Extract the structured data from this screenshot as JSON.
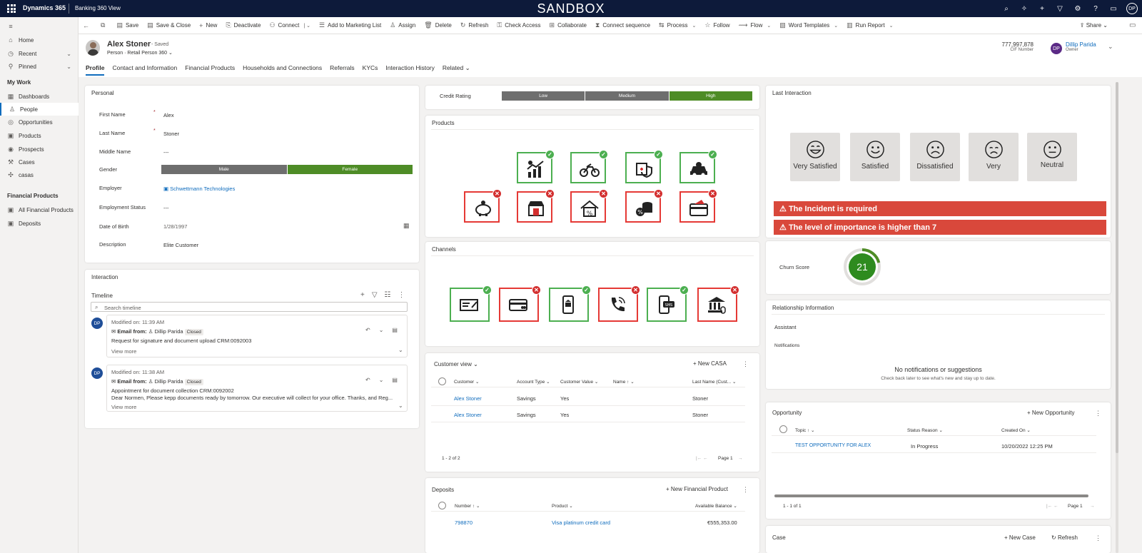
{
  "topbar": {
    "brand": "Dynamics 365",
    "app_name": "Banking 360 View",
    "environment": "SANDBOX",
    "user_initials": "DP"
  },
  "leftnav": {
    "items": [
      {
        "label": "Home",
        "icon": "home-icon"
      },
      {
        "label": "Recent",
        "icon": "clock-icon"
      },
      {
        "label": "Pinned",
        "icon": "pin-icon"
      }
    ],
    "my_work_header": "My Work",
    "my_work": [
      {
        "label": "Dashboards"
      },
      {
        "label": "People"
      },
      {
        "label": "Opportunities"
      },
      {
        "label": "Products"
      },
      {
        "label": "Prospects"
      },
      {
        "label": "Cases"
      },
      {
        "label": "casas"
      }
    ],
    "financial_header": "Financial Products",
    "financial": [
      {
        "label": "All Financial Products"
      },
      {
        "label": "Deposits"
      }
    ]
  },
  "commands": [
    {
      "label": "Save",
      "icon": "save-icon"
    },
    {
      "label": "Save & Close",
      "icon": "save-close-icon"
    },
    {
      "label": "New",
      "icon": "plus-icon"
    },
    {
      "label": "Deactivate",
      "icon": "deactivate-icon"
    },
    {
      "label": "Connect",
      "icon": "connect-icon"
    },
    {
      "label": "Add to Marketing List",
      "icon": "list-icon"
    },
    {
      "label": "Assign",
      "icon": "assign-icon"
    },
    {
      "label": "Delete",
      "icon": "trash-icon"
    },
    {
      "label": "Refresh",
      "icon": "refresh-icon"
    },
    {
      "label": "Check Access",
      "icon": "check-access-icon"
    },
    {
      "label": "Collaborate",
      "icon": "collaborate-icon"
    },
    {
      "label": "Connect sequence",
      "icon": "sequence-icon"
    },
    {
      "label": "Process",
      "icon": "process-icon"
    },
    {
      "label": "Follow",
      "icon": "star-icon"
    },
    {
      "label": "Flow",
      "icon": "flow-icon"
    },
    {
      "label": "Word Templates",
      "icon": "word-icon"
    },
    {
      "label": "Run Report",
      "icon": "report-icon"
    }
  ],
  "share_label": "Share",
  "record": {
    "name": "Alex Stoner",
    "saved": "- Saved",
    "entity": "Person",
    "form": "Retail Person 360",
    "cif_value": "777,997,878",
    "cif_label": "CIF Number",
    "owner_initials": "DP",
    "owner_name": "Dillip Parida",
    "owner_label": "Owner"
  },
  "tabs": [
    "Profile",
    "Contact and Information",
    "Financial Products",
    "Households and Connections",
    "Referrals",
    "KYCs",
    "Interaction History",
    "Related"
  ],
  "personal": {
    "title": "Personal",
    "first_name_label": "First Name",
    "first_name": "Alex",
    "last_name_label": "Last Name",
    "last_name": "Stoner",
    "middle_name_label": "Middle Name",
    "middle_name": "---",
    "gender_label": "Gender",
    "gender_male": "Male",
    "gender_female": "Female",
    "employer_label": "Employer",
    "employer": "Schwettmann Technologies",
    "employment_label": "Employment Status",
    "employment": "---",
    "dob_label": "Date of Birth",
    "dob": "1/28/1997",
    "desc_label": "Description",
    "desc": "Elite Customer"
  },
  "interaction": {
    "title": "Interaction",
    "timeline_label": "Timeline",
    "search_placeholder": "Search timeline",
    "entries": [
      {
        "initials": "DP",
        "modified": "Modified on: 11:39 AM",
        "from_label": "Email from:",
        "from": "Dillip Parida",
        "status": "Closed",
        "subject": "Request for signature and document upload CRM:0092003",
        "body": "",
        "more": "View more"
      },
      {
        "initials": "DP",
        "modified": "Modified on: 11:38 AM",
        "from_label": "Email from:",
        "from": "Dillip Parida",
        "status": "Closed",
        "subject": "Appointment for document collection CRM:0092002",
        "body": "Dear Normen,   Please kepp documents ready by tomorrow. Our executive will collect for your office.  Thanks, and Reg...",
        "more": "View more"
      }
    ]
  },
  "credit": {
    "label": "Credit Rating",
    "low": "Low",
    "medium": "Medium",
    "high": "High"
  },
  "products_title": "Products",
  "channels_title": "Channels",
  "customer_view": {
    "title": "Customer view",
    "new_label": "New CASA",
    "headers": [
      "Customer",
      "Account Type",
      "Customer Value",
      "Name",
      "Last Name (Cust..."
    ],
    "rows": [
      [
        "Alex Stoner",
        "Savings",
        "Yes",
        "",
        "Stoner"
      ],
      [
        "Alex Stoner",
        "Savings",
        "Yes",
        "",
        "Stoner"
      ]
    ],
    "count": "1 - 2 of 2",
    "page": "Page 1"
  },
  "deposits": {
    "title": "Deposits",
    "new_label": "New Financial Product",
    "headers": [
      "Number",
      "Product",
      "Available Balance"
    ],
    "rows": [
      [
        "798870",
        "Visa platinum credit card",
        "€555,353.00"
      ]
    ]
  },
  "last_interaction": {
    "title": "Last Interaction",
    "faces": [
      "Very Satisfied",
      "Satisfied",
      "Dissatisfied",
      "Very",
      "Neutral"
    ],
    "alerts": [
      "The Incident is required",
      "The level of importance is higher than 7"
    ]
  },
  "churn": {
    "label": "Churn Score",
    "value": "21",
    "fraction": 0.21
  },
  "relationship": {
    "title": "Relationship Information",
    "assistant": "Assistant",
    "notifications": "Notifications",
    "empty_title": "No notifications or suggestions",
    "empty_sub": "Check back later to see what's new and stay up to date."
  },
  "opportunity": {
    "title": "Opportunity",
    "new_label": "New Opportunity",
    "headers": [
      "Topic",
      "Status Reason",
      "Created On"
    ],
    "rows": [
      [
        "TEST OPPORTUNITY FOR ALEX",
        "In Progress",
        "10/20/2022 12:25 PM"
      ]
    ],
    "count": "1 - 1 of 1",
    "page": "Page 1"
  },
  "case": {
    "title": "Case",
    "new_label": "New Case",
    "refresh_label": "Refresh"
  },
  "colors": {
    "accent": "#0f6cbd",
    "green": "#4e8c26",
    "red_alert": "#d9483b"
  }
}
